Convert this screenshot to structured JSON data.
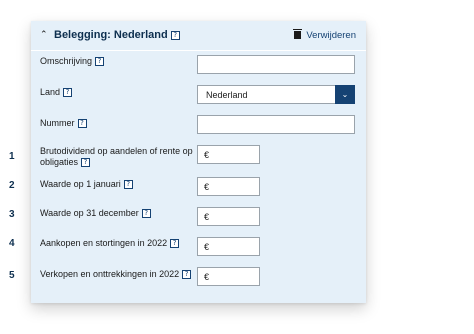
{
  "section": {
    "title": "Belegging: Nederland",
    "help_glyph": "?",
    "remove_label": "Verwijderen",
    "collapse_icon": "chevron-up-icon",
    "remove_icon": "trash-icon"
  },
  "fields": {
    "omschrijving": {
      "label": "Omschrijving",
      "value": ""
    },
    "land": {
      "label": "Land",
      "value": "Nederland"
    },
    "nummer": {
      "label": "Nummer",
      "value": ""
    },
    "brutodividend": {
      "label_line1": "Brutodividend op aandelen of rente op",
      "label_line2": "obligaties",
      "currency": "€",
      "value": ""
    },
    "waarde_begin": {
      "label": "Waarde op 1 januari",
      "currency": "€",
      "value": ""
    },
    "waarde_eind": {
      "label": "Waarde op 31 december",
      "currency": "€",
      "value": ""
    },
    "aankopen": {
      "label": "Aankopen en stortingen in 2022",
      "currency": "€",
      "value": ""
    },
    "verkopen": {
      "label": "Verkopen en onttrekkingen in 2022",
      "currency": "€",
      "value": ""
    }
  },
  "markers": [
    "1",
    "2",
    "3",
    "4",
    "5"
  ]
}
